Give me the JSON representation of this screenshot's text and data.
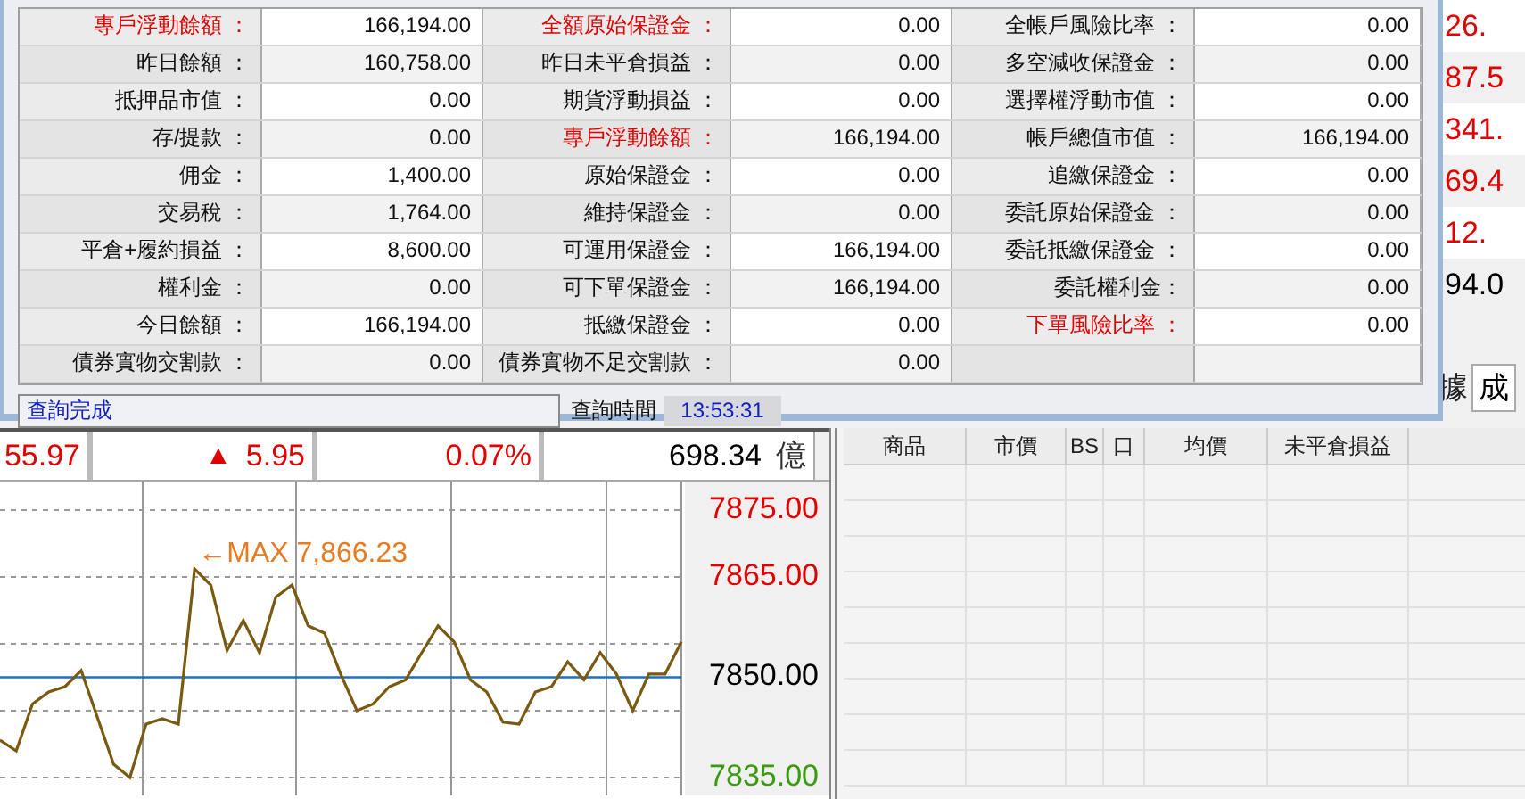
{
  "account_dialog": {
    "rows": [
      {
        "cells": [
          {
            "label": "專戶浮動餘額 ：",
            "value": "166,194.00",
            "alert": true
          },
          {
            "label": "全額原始保證金 ：",
            "value": "0.00",
            "alert": true
          },
          {
            "label": "全帳戶風險比率 ：",
            "value": "0.00",
            "alert": false
          }
        ]
      },
      {
        "cells": [
          {
            "label": "昨日餘額 ：",
            "value": "160,758.00",
            "alert": false
          },
          {
            "label": "昨日未平倉損益 ：",
            "value": "0.00",
            "alert": false
          },
          {
            "label": "多空減收保證金 ：",
            "value": "0.00",
            "alert": false
          }
        ]
      },
      {
        "cells": [
          {
            "label": "抵押品市值 ：",
            "value": "0.00",
            "alert": false
          },
          {
            "label": "期貨浮動損益 ：",
            "value": "0.00",
            "alert": false
          },
          {
            "label": "選擇權浮動市值 ：",
            "value": "0.00",
            "alert": false
          }
        ]
      },
      {
        "cells": [
          {
            "label": "存/提款 ：",
            "value": "0.00",
            "alert": false
          },
          {
            "label": "專戶浮動餘額 ：",
            "value": "166,194.00",
            "alert": true
          },
          {
            "label": "帳戶總值市值 ：",
            "value": "166,194.00",
            "alert": false
          }
        ]
      },
      {
        "cells": [
          {
            "label": "佣金 ：",
            "value": "1,400.00",
            "alert": false
          },
          {
            "label": "原始保證金 ：",
            "value": "0.00",
            "alert": false
          },
          {
            "label": "追繳保證金 ：",
            "value": "0.00",
            "alert": false
          }
        ]
      },
      {
        "cells": [
          {
            "label": "交易稅 ：",
            "value": "1,764.00",
            "alert": false
          },
          {
            "label": "維持保證金 ：",
            "value": "0.00",
            "alert": false
          },
          {
            "label": "委託原始保證金 ：",
            "value": "0.00",
            "alert": false
          }
        ]
      },
      {
        "cells": [
          {
            "label": "平倉+履約損益 ：",
            "value": "8,600.00",
            "alert": false
          },
          {
            "label": "可運用保證金 ：",
            "value": "166,194.00",
            "alert": false
          },
          {
            "label": "委託抵繳保證金 ：",
            "value": "0.00",
            "alert": false
          }
        ]
      },
      {
        "cells": [
          {
            "label": "權利金 ：",
            "value": "0.00",
            "alert": false
          },
          {
            "label": "可下單保證金 ：",
            "value": "166,194.00",
            "alert": false
          },
          {
            "label": "委託權利金：",
            "value": "0.00",
            "alert": false
          }
        ]
      },
      {
        "cells": [
          {
            "label": "今日餘額 ：",
            "value": "166,194.00",
            "alert": false
          },
          {
            "label": "抵繳保證金 ：",
            "value": "0.00",
            "alert": false
          },
          {
            "label": "下單風險比率 ：",
            "value": "0.00",
            "alert": true
          }
        ]
      },
      {
        "cells": [
          {
            "label": "債券實物交割款 ：",
            "value": "0.00",
            "alert": false
          },
          {
            "label": "債券實物不足交割款 ：",
            "value": "0.00",
            "alert": false
          }
        ]
      }
    ],
    "status_bar": {
      "message": "查詢完成",
      "time_label": "查詢時間",
      "time": "13:53:31"
    }
  },
  "side_values": [
    {
      "text": "26.",
      "up": true
    },
    {
      "text": "87.5",
      "up": true
    },
    {
      "text": "341.",
      "up": true
    },
    {
      "text": "69.4",
      "up": true
    },
    {
      "text": "12.",
      "up": true
    },
    {
      "text": "94.0",
      "up": false
    }
  ],
  "side_controls": {
    "label": "據",
    "field_value": "成"
  },
  "quote_bar": {
    "price": "55.97",
    "change_arrow": "▲",
    "change": "5.95",
    "change_percent": "0.07%",
    "volume": "698.34",
    "volume_unit": "億"
  },
  "price_chart": {
    "chart_data": {
      "type": "line",
      "ylim": [
        7832.33,
        7879.27
      ],
      "yticks": [
        {
          "value": 7835,
          "label": "7835.00"
        },
        {
          "value": 7850,
          "label": "7850.00"
        },
        {
          "value": 7865,
          "label": "7865.00"
        },
        {
          "value": 7875,
          "label": "7875.00"
        }
      ],
      "categories": [
        null,
        null,
        null,
        null,
        null,
        null,
        null,
        null,
        null,
        null,
        null,
        null,
        null,
        null,
        null,
        null,
        null,
        null,
        null,
        null,
        null,
        null,
        null,
        null,
        null,
        null,
        null,
        null,
        null,
        null,
        null,
        null,
        null,
        null,
        null,
        null,
        null,
        null,
        null,
        null,
        null,
        null,
        null
      ],
      "series": [
        {
          "color": "#7a5a10",
          "values": [
            7840.6,
            7839,
            7846,
            7847.8,
            7848.6,
            7851,
            7844,
            7837,
            7835,
            7843,
            7843.8,
            7843,
            7866.2,
            7863.8,
            7854,
            7858.5,
            7853.7,
            7862,
            7863.8,
            7857.7,
            7856.6,
            7850.5,
            7845,
            7846,
            7848.6,
            7849.6,
            7853.7,
            7857.7,
            7855.3,
            7849.6,
            7847.8,
            7843.3,
            7843,
            7847.8,
            7848.6,
            7852.3,
            7849.6,
            7853.7,
            7850.5,
            7845,
            7850.5,
            7850.5,
            7855.3
          ]
        }
      ],
      "grid": true,
      "ref_lines": [
        {
          "axis": "y",
          "value": 7850
        }
      ],
      "annotations": [
        {
          "text": "←MAX 7,866.23"
        }
      ]
    }
  },
  "positions_table": {
    "columns": [
      "商品",
      "市價",
      "BS",
      "口",
      "均價",
      "未平倉損益"
    ]
  }
}
